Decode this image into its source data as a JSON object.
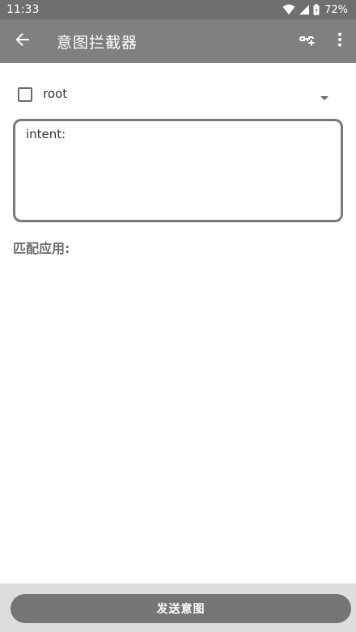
{
  "status_bar": {
    "time": "11:33",
    "battery": "72%"
  },
  "app_bar": {
    "title": "意图拦截器",
    "icons": {
      "back": "arrow-back-icon",
      "add_link": "add-link-icon",
      "more": "more-vert-icon"
    }
  },
  "root_row": {
    "checked": false,
    "label": "root"
  },
  "intent_input": {
    "value": "intent:"
  },
  "match_section": {
    "label": "匹配应用:"
  },
  "bottom": {
    "send_label": "发送意图"
  },
  "colors": {
    "status_bar": "#6f6f6f",
    "app_bar": "#808080",
    "button": "#757575",
    "bottom_bar": "#dddddd"
  }
}
